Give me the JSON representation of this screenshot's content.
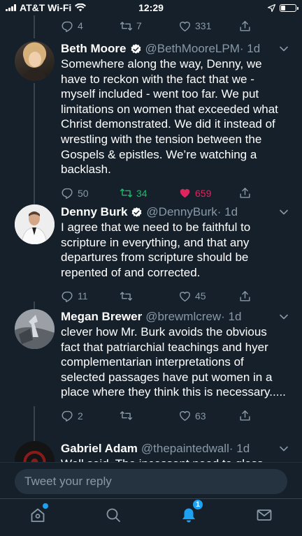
{
  "status_bar": {
    "carrier": "AT&T Wi-Fi",
    "time": "12:29"
  },
  "top_partial_tweet": {
    "replies": "4",
    "retweets": "7",
    "likes": "331"
  },
  "tweets": [
    {
      "name": "Beth Moore",
      "handle": "@BethMooreLPM",
      "time": "· 1d",
      "verified": true,
      "text": "Somewhere along the way, Denny, we have to reckon with the fact that we - myself included - went too far. We put limitations on women that exceeded what Christ demonstrated. We did it instead of wrestling with the tension between the Gospels & epistles. We’re watching a backlash.",
      "replies": "50",
      "retweets": "34",
      "likes": "659",
      "retweeted": true,
      "liked": true
    },
    {
      "name": "Denny Burk",
      "handle": "@DennyBurk",
      "time": "· 1d",
      "verified": true,
      "text": "I agree that we need to be faithful to scripture in everything, and that any departures from scripture should be repented of and corrected.",
      "replies": "11",
      "retweets": "",
      "likes": "45",
      "retweeted": false,
      "liked": false
    },
    {
      "name": "Megan Brewer",
      "handle": "@brewmlcrew",
      "time": "· 1d",
      "verified": false,
      "text": "clever how Mr. Burk avoids the obvious fact that patriarchial teachings and hyer complementarian interpretations of selected passages have put women in a place where they think this is necessary.....",
      "replies": "2",
      "retweets": "",
      "likes": "63",
      "retweeted": false,
      "liked": false
    },
    {
      "name": "Gabriel Adam",
      "handle": "@thepaintedwall",
      "time": "· 1d",
      "verified": false,
      "text": "Well said. The incessant need to gloss"
    }
  ],
  "reply_bar": {
    "placeholder": "Tweet your reply"
  },
  "tab_bar": {
    "notifications_badge": "1",
    "items": [
      "home-icon",
      "search-icon",
      "notifications-icon",
      "messages-icon"
    ]
  },
  "colors": {
    "background": "#15202b",
    "muted": "#8899a6",
    "accent": "#1da1f2",
    "retweet_green": "#17bf63",
    "like_red": "#e0245e"
  }
}
